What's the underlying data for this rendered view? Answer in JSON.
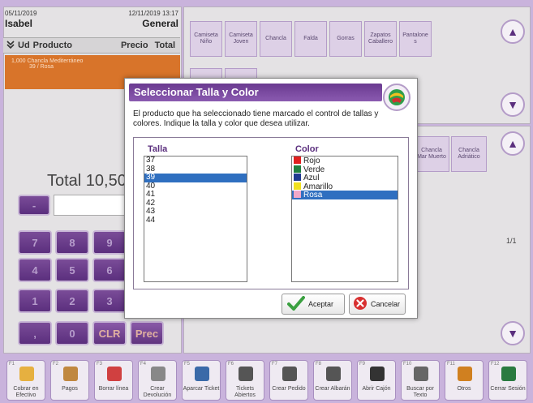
{
  "header": {
    "date_left": "05/11/2019",
    "user": "Isabel",
    "date_right": "12/11/2019 13:17",
    "customer": "General"
  },
  "ticket": {
    "columns": [
      "Ud",
      "Producto",
      "Precio",
      "Total"
    ],
    "line": {
      "qty": "1,000",
      "product": "Chancla Mediterráneo",
      "detail": "39 / Rosa"
    },
    "total_label": "Total 10,50"
  },
  "keypad": [
    "7",
    "8",
    "9",
    "4",
    "5",
    "6",
    "1",
    "2",
    "3",
    ",",
    "0",
    "CLR",
    "Prec"
  ],
  "products_top": [
    "Camiseta Niño",
    "Camiseta Joven",
    "Chancla",
    "Falda",
    "Gorras",
    "Zapatos Caballero",
    "Pantalone s"
  ],
  "products_mid": [
    "Chancla Mar Muerto",
    "Chancla Adriático"
  ],
  "page_indicator": "1/1",
  "toolbar": [
    {
      "key": "F1",
      "label": "Cobrar en Efectivo",
      "icon": "cash-icon",
      "color": "#e6b040"
    },
    {
      "key": "F2",
      "label": "Pagos",
      "icon": "payments-icon",
      "color": "#c08840"
    },
    {
      "key": "F3",
      "label": "Borrar línea",
      "icon": "delete-line-icon",
      "color": "#d04040"
    },
    {
      "key": "F4",
      "label": "Crear Devolución",
      "icon": "return-icon",
      "color": "#888888"
    },
    {
      "key": "F5",
      "label": "Aparcar Ticket",
      "icon": "park-ticket-icon",
      "color": "#3a6aa8"
    },
    {
      "key": "F6",
      "label": "Tickets Abiertos",
      "icon": "open-tickets-icon",
      "color": "#555555"
    },
    {
      "key": "F7",
      "label": "Crear Pedido",
      "icon": "create-order-icon",
      "color": "#555555"
    },
    {
      "key": "F8",
      "label": "Crear Albarán",
      "icon": "create-delivery-note-icon",
      "color": "#555555"
    },
    {
      "key": "F9",
      "label": "Abrir Cajón",
      "icon": "open-drawer-icon",
      "color": "#333333"
    },
    {
      "key": "F10",
      "label": "Buscar por Texto",
      "icon": "search-icon",
      "color": "#666666"
    },
    {
      "key": "F11",
      "label": "Otros",
      "icon": "other-icon",
      "color": "#d08020"
    },
    {
      "key": "F12",
      "label": "Cerrar Sesión",
      "icon": "logout-icon",
      "color": "#2a7a40"
    }
  ],
  "dialog": {
    "title": "Seleccionar Talla y Color",
    "message": "El producto que ha seleccionado tiene marcado el control de tallas y colores. Indique la talla y color que desea utilizar.",
    "talla_title": "Talla",
    "color_title": "Color",
    "tallas": [
      "37",
      "38",
      "39",
      "40",
      "41",
      "42",
      "43",
      "44"
    ],
    "selected_talla": "39",
    "colores": [
      {
        "name": "Rojo",
        "hex": "#e02020"
      },
      {
        "name": "Verde",
        "hex": "#208040"
      },
      {
        "name": "Azul",
        "hex": "#203a90"
      },
      {
        "name": "Amarillo",
        "hex": "#f0e020"
      },
      {
        "name": "Rosa",
        "hex": "#f0a8c8"
      }
    ],
    "selected_color": "Rosa",
    "accept_label": "Aceptar",
    "cancel_label": "Cancelar"
  }
}
